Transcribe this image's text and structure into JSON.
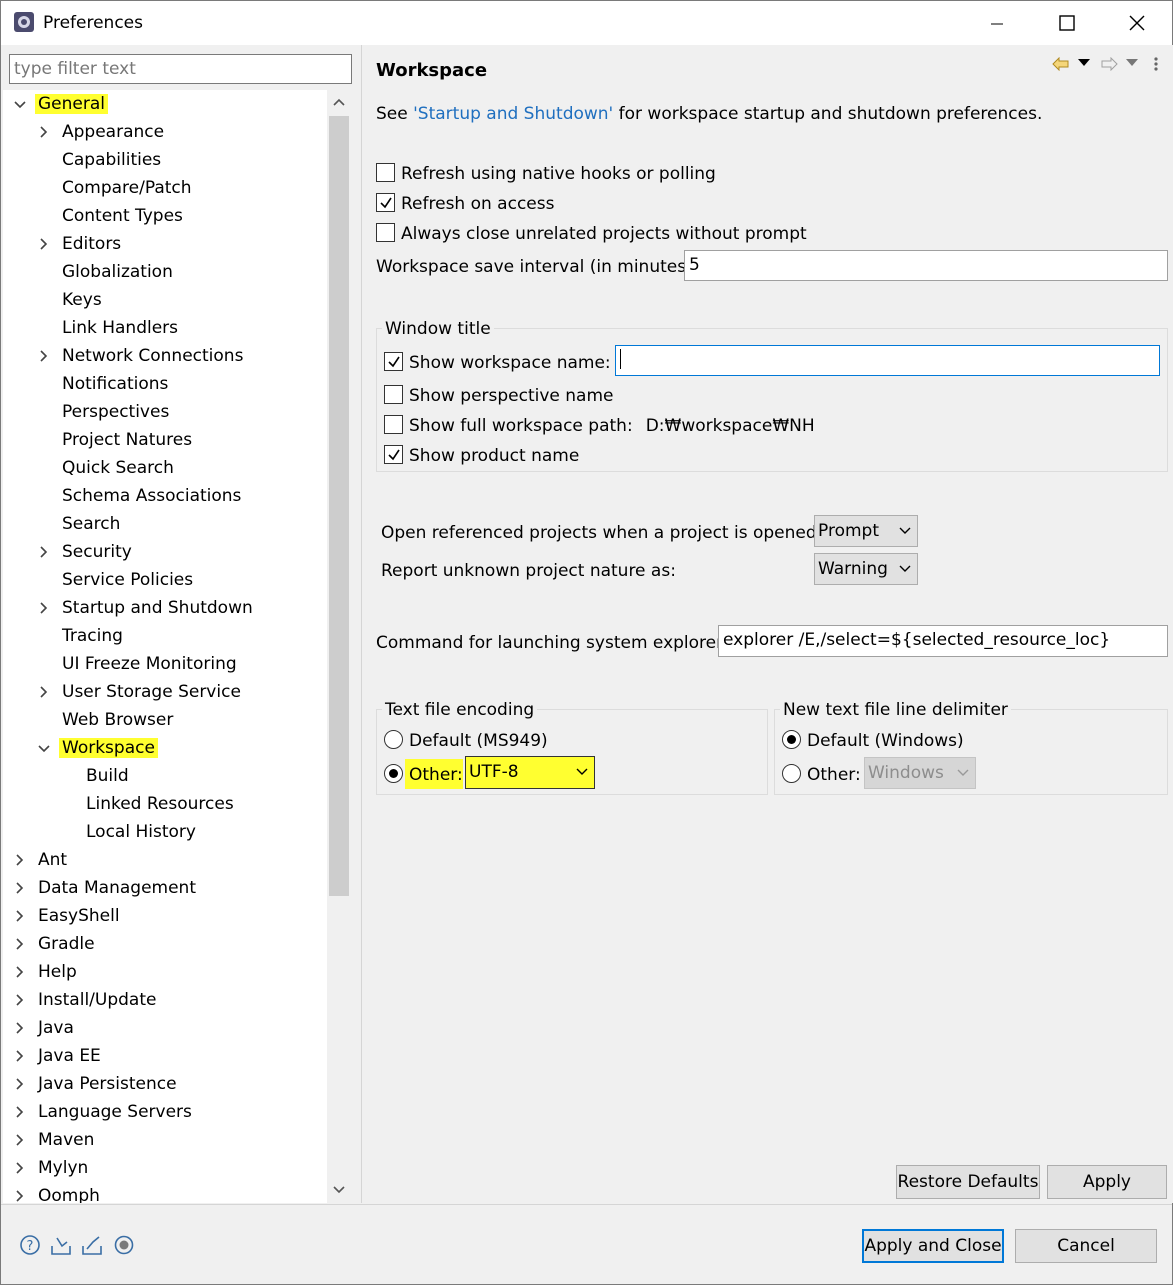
{
  "window": {
    "title": "Preferences"
  },
  "left": {
    "filter_placeholder": "type filter text",
    "general": {
      "label": "General",
      "children": [
        {
          "label": "Appearance",
          "expandable": true
        },
        {
          "label": "Capabilities",
          "expandable": false
        },
        {
          "label": "Compare/Patch",
          "expandable": false
        },
        {
          "label": "Content Types",
          "expandable": false
        },
        {
          "label": "Editors",
          "expandable": true
        },
        {
          "label": "Globalization",
          "expandable": false
        },
        {
          "label": "Keys",
          "expandable": false
        },
        {
          "label": "Link Handlers",
          "expandable": false
        },
        {
          "label": "Network Connections",
          "expandable": true
        },
        {
          "label": "Notifications",
          "expandable": false
        },
        {
          "label": "Perspectives",
          "expandable": false
        },
        {
          "label": "Project Natures",
          "expandable": false
        },
        {
          "label": "Quick Search",
          "expandable": false
        },
        {
          "label": "Schema Associations",
          "expandable": false
        },
        {
          "label": "Search",
          "expandable": false
        },
        {
          "label": "Security",
          "expandable": true
        },
        {
          "label": "Service Policies",
          "expandable": false
        },
        {
          "label": "Startup and Shutdown",
          "expandable": true
        },
        {
          "label": "Tracing",
          "expandable": false
        },
        {
          "label": "UI Freeze Monitoring",
          "expandable": false
        },
        {
          "label": "User Storage Service",
          "expandable": true
        },
        {
          "label": "Web Browser",
          "expandable": false
        }
      ],
      "workspace": {
        "label": "Workspace",
        "children": [
          "Build",
          "Linked Resources",
          "Local History"
        ]
      }
    },
    "top_level": [
      "Ant",
      "Data Management",
      "EasyShell",
      "Gradle",
      "Help",
      "Install/Update",
      "Java",
      "Java EE",
      "Java Persistence",
      "Language Servers",
      "Maven",
      "Mylyn",
      "Oomph"
    ]
  },
  "page": {
    "title": "Workspace",
    "intro_see": "See ",
    "intro_link": "'Startup and Shutdown'",
    "intro_rest": " for workspace startup and shutdown preferences.",
    "refresh_native": {
      "label": "Refresh using native hooks or polling",
      "checked": false
    },
    "refresh_access": {
      "label": "Refresh on access",
      "checked": true
    },
    "always_close": {
      "label": "Always close unrelated projects without prompt",
      "checked": false
    },
    "save_interval_label": "Workspace save interval (in minutes):",
    "save_interval_value": "5",
    "window_title": {
      "group_label": "Window title",
      "show_ws_name": {
        "label": "Show workspace name:",
        "checked": true,
        "value": ""
      },
      "show_perspective": {
        "label": "Show perspective name",
        "checked": false
      },
      "show_full_path": {
        "label": "Show full workspace path:",
        "checked": false,
        "path": "D:₩workspace₩NH"
      },
      "show_product": {
        "label": "Show product name",
        "checked": true
      }
    },
    "open_ref_label": "Open referenced projects when a project is opened:",
    "open_ref_value": "Prompt",
    "report_unknown_label": "Report unknown project nature as:",
    "report_unknown_value": "Warning",
    "explorer_label": "Command for launching system explorer:",
    "explorer_value": "explorer /E,/select=${selected_resource_loc}",
    "encoding": {
      "group_label": "Text file encoding",
      "default_label": "Default (MS949)",
      "other_label": "Other:",
      "other_value": "UTF-8",
      "selected": "other"
    },
    "delimiter": {
      "group_label": "New text file line delimiter",
      "default_label": "Default (Windows)",
      "other_label": "Other:",
      "other_value": "Windows",
      "selected": "default"
    },
    "restore_defaults": "Restore Defaults",
    "apply": "Apply"
  },
  "footer": {
    "apply_close": "Apply and Close",
    "cancel": "Cancel"
  },
  "highlight_color": "#ffff30",
  "accent_color": "#0078d7",
  "link_color": "#1f6fbf"
}
